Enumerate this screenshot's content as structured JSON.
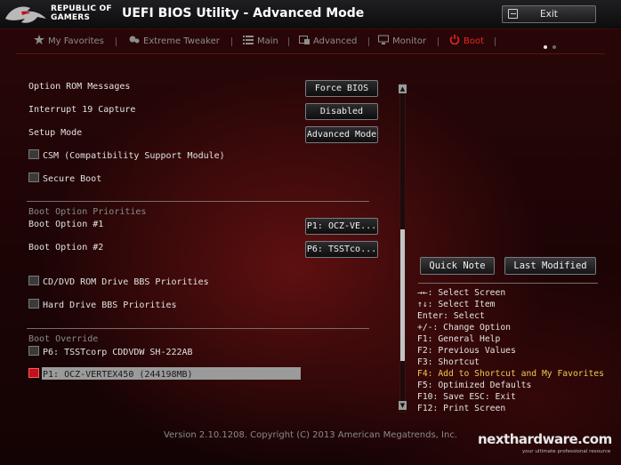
{
  "header": {
    "brand_line1": "REPUBLIC OF",
    "brand_line2": "GAMERS",
    "title": "UEFI BIOS Utility - Advanced Mode",
    "exit_label": "Exit"
  },
  "tabs": [
    {
      "label": "My Favorites",
      "icon": "star-icon",
      "active": false
    },
    {
      "label": "Extreme Tweaker",
      "icon": "tweaker-icon",
      "active": false
    },
    {
      "label": "Main",
      "icon": "list-icon",
      "active": false
    },
    {
      "label": "Advanced",
      "icon": "advanced-icon",
      "active": false
    },
    {
      "label": "Monitor",
      "icon": "monitor-icon",
      "active": false
    },
    {
      "label": "Boot",
      "icon": "power-icon",
      "active": true
    }
  ],
  "settings": {
    "option_rom": {
      "label": "Option ROM Messages",
      "value": "Force BIOS"
    },
    "interrupt19": {
      "label": "Interrupt 19 Capture",
      "value": "Disabled"
    },
    "setup_mode": {
      "label": "Setup Mode",
      "value": "Advanced Mode"
    },
    "csm": {
      "label": "CSM (Compatibility Support Module)"
    },
    "secure_boot": {
      "label": "Secure Boot"
    }
  },
  "boot_priorities": {
    "section_label": "Boot Option Priorities",
    "option1": {
      "label": "Boot Option #1",
      "value": "P1: OCZ-VE..."
    },
    "option2": {
      "label": "Boot Option #2",
      "value": "P6: TSSTco..."
    },
    "cd_dvd": {
      "label": "CD/DVD ROM Drive BBS Priorities"
    },
    "hdd": {
      "label": "Hard Drive BBS Priorities"
    }
  },
  "boot_override": {
    "section_label": "Boot Override",
    "item1": "P6: TSSTcorp CDDVDW SH-222AB",
    "item2": "P1: OCZ-VERTEX450  (244198MB)"
  },
  "panel": {
    "quick_note": "Quick Note",
    "last_modified": "Last Modified",
    "help": [
      {
        "text": "→←: Select Screen",
        "highlight": false
      },
      {
        "text": "↑↓: Select Item",
        "highlight": false
      },
      {
        "text": "Enter: Select",
        "highlight": false
      },
      {
        "text": "+/-: Change Option",
        "highlight": false
      },
      {
        "text": "F1: General Help",
        "highlight": false
      },
      {
        "text": "F2: Previous Values",
        "highlight": false
      },
      {
        "text": "F3: Shortcut",
        "highlight": false
      },
      {
        "text": "F4: Add to Shortcut and My Favorites",
        "highlight": true
      },
      {
        "text": "F5: Optimized Defaults",
        "highlight": false
      },
      {
        "text": "F10: Save  ESC: Exit",
        "highlight": false
      },
      {
        "text": "F12: Print Screen",
        "highlight": false
      }
    ]
  },
  "footer": {
    "version": "Version 2.10.1208. Copyright (C) 2013 American Megatrends, Inc."
  },
  "watermark": {
    "title": "nexthardware.com",
    "subtitle": "your ultimate professional resource"
  },
  "colors": {
    "accent": "#e8271e",
    "highlight_text": "#f2c94c"
  }
}
